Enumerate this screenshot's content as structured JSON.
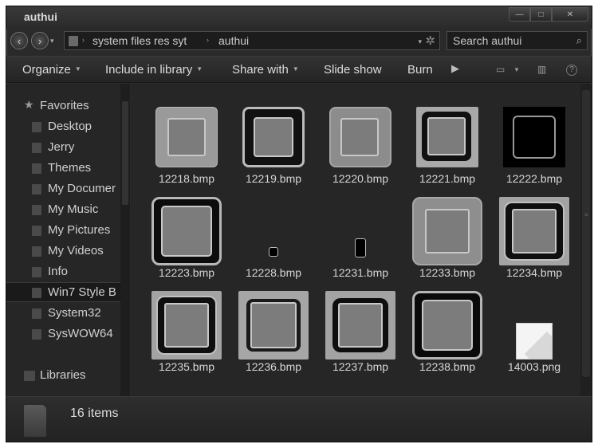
{
  "window": {
    "title": "authui"
  },
  "title_buttons": {
    "minimize": "—",
    "maximize": "□",
    "close": "✕"
  },
  "nav_buttons": {
    "back": "‹",
    "forward": "›",
    "recent": "▾"
  },
  "address": {
    "segments": [
      "system files res syt",
      "authui"
    ],
    "separator": "›",
    "dropdown": "▾",
    "refresh": "✲"
  },
  "search": {
    "placeholder": "Search authui",
    "icon": "⌕"
  },
  "toolbar": {
    "organize": "Organize",
    "include_in_library": "Include in library",
    "share_with": "Share with",
    "slide_show": "Slide show",
    "burn": "Burn",
    "more": "▶",
    "dropdown_arrow": "▼",
    "views_icon": "▭",
    "preview_icon": "▥",
    "help_icon": "?"
  },
  "navigation": {
    "favorites_label": "Favorites",
    "favorites_icon": "★",
    "items": [
      {
        "label": "Desktop",
        "icon": "desktop-folder-icon"
      },
      {
        "label": "Jerry",
        "icon": "user-folder-icon"
      },
      {
        "label": "Themes",
        "icon": "folder-icon"
      },
      {
        "label": "My Documer",
        "icon": "documents-folder-icon"
      },
      {
        "label": "My Music",
        "icon": "music-folder-icon"
      },
      {
        "label": "My Pictures",
        "icon": "pictures-folder-icon"
      },
      {
        "label": "My Videos",
        "icon": "videos-folder-icon"
      },
      {
        "label": "Info",
        "icon": "folder-icon"
      },
      {
        "label": "Win7 Style B",
        "icon": "folder-icon",
        "selected": true
      },
      {
        "label": "System32",
        "icon": "folder-icon"
      },
      {
        "label": "SysWOW64",
        "icon": "folder-icon"
      }
    ],
    "libraries_label": "Libraries"
  },
  "files": [
    {
      "name": "12218.bmp",
      "style": "soft-frame"
    },
    {
      "name": "12219.bmp",
      "style": "dark-frame"
    },
    {
      "name": "12220.bmp",
      "style": "soft-frame"
    },
    {
      "name": "12221.bmp",
      "style": "dark-frame"
    },
    {
      "name": "12222.bmp",
      "style": "black-tile"
    },
    {
      "name": "12223.bmp",
      "style": "dark-frame"
    },
    {
      "name": "12228.bmp",
      "style": "tiny-dot"
    },
    {
      "name": "12231.bmp",
      "style": "small-pill"
    },
    {
      "name": "12233.bmp",
      "style": "soft-frame"
    },
    {
      "name": "12234.bmp",
      "style": "dark-frame"
    },
    {
      "name": "12235.bmp",
      "style": "dark-frame"
    },
    {
      "name": "12236.bmp",
      "style": "soft-frame"
    },
    {
      "name": "12237.bmp",
      "style": "dark-frame"
    },
    {
      "name": "12238.bmp",
      "style": "dark-frame"
    },
    {
      "name": "14003.png",
      "style": "white-page"
    }
  ],
  "status": {
    "item_count": "16 items"
  },
  "colors": {
    "window_bg": "#262626",
    "text": "#d6d6d6",
    "thumb_gray": "#7c7c7c"
  }
}
